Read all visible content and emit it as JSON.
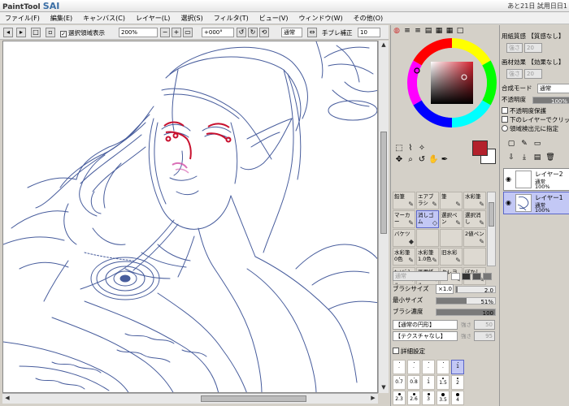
{
  "app": {
    "logo_small": "PaintTool",
    "logo_big": "SAI",
    "trial_notice": "あと21日 試用日日1"
  },
  "menu": [
    "ファイル(F)",
    "編集(E)",
    "キャンバス(C)",
    "レイヤー(L)",
    "選択(S)",
    "フィルタ(T)",
    "ビュー(V)",
    "ウィンドウ(W)",
    "その他(O)"
  ],
  "toolbar": {
    "show_selection_label": "選択領域表示",
    "zoom_value": "200%",
    "angle_value": "+000°",
    "blend_mode": "通常",
    "stabilizer_label": "手ブレ補正",
    "stabilizer_value": "10"
  },
  "tools": [
    {
      "label": "鉛筆",
      "icon": "✎"
    },
    {
      "label": "エアブラシ",
      "icon": "✎"
    },
    {
      "label": "筆",
      "icon": "✎"
    },
    {
      "label": "水彩筆",
      "icon": "✎"
    },
    {
      "label": "マーカー",
      "icon": "✎"
    },
    {
      "label": "消しゴム",
      "icon": "◇"
    },
    {
      "label": "選択ペン",
      "icon": "✎"
    },
    {
      "label": "選択消し",
      "icon": "✎"
    },
    {
      "label": "バケツ",
      "icon": "◆"
    },
    {
      "label": "",
      "icon": ""
    },
    {
      "label": "",
      "icon": ""
    },
    {
      "label": "2値ペン",
      "icon": "✎"
    },
    {
      "label": "水彩筆 0色",
      "icon": "✎"
    },
    {
      "label": "水彩筆 1.0色",
      "icon": "✎"
    },
    {
      "label": "旧水彩",
      "icon": "✎"
    },
    {
      "label": "",
      "icon": ""
    },
    {
      "label": "ｷｬﾝﾊﾞｽ アクリル",
      "icon": "✎"
    },
    {
      "label": "画用紙 アクリル",
      "icon": "✎"
    },
    {
      "label": "クレヨン",
      "icon": "✎"
    },
    {
      "label": "ぼかし",
      "icon": "✎"
    }
  ],
  "brush": {
    "mode": "通常",
    "size_label": "ブラシサイズ",
    "size_mult": "×1.0",
    "size_value": "2.0",
    "size_fill": 0.05,
    "min_size_label": "最小サイズ",
    "min_size_value": "51%",
    "min_size_fill": 0.51,
    "density_label": "ブラシ濃度",
    "density_value": "100",
    "density_fill": 1.0,
    "shape": "【通常の円形】",
    "shape_strength": "強さ",
    "shape_strength_value": "50",
    "texture": "【テクスチャなし】",
    "texture_strength": "強さ",
    "texture_strength_value": "95",
    "detail_label": "詳細設定"
  },
  "size_presets": [
    {
      "label": ".",
      "dot": 1
    },
    {
      "label": ".",
      "dot": 1
    },
    {
      "label": ".",
      "dot": 1
    },
    {
      "label": ".",
      "dot": 1
    },
    {
      "label": "1",
      "dot": 1
    },
    {
      "label": "0.7",
      "dot": 1
    },
    {
      "label": "0.8",
      "dot": 1
    },
    {
      "label": "1",
      "dot": 1
    },
    {
      "label": "1.5",
      "dot": 2
    },
    {
      "label": "2",
      "dot": 2
    },
    {
      "label": "2.3",
      "dot": 3
    },
    {
      "label": "2.6",
      "dot": 3
    },
    {
      "label": "3",
      "dot": 3
    },
    {
      "label": "3.5",
      "dot": 4
    },
    {
      "label": "4",
      "dot": 4
    }
  ],
  "layers_panel": {
    "paper_texture_label": "用紙質感",
    "paper_texture_value": "【質感なし】",
    "paper_strength_label": "強さ",
    "paper_strength_value": "20",
    "paper_effect_label": "画材効果",
    "paper_effect_value": "【効果なし】",
    "paper_effect_strength_label": "強さ",
    "paper_effect_strength_value": "20",
    "blend_label": "合成モード",
    "blend_value": "通常",
    "opacity_label": "不透明度",
    "opacity_value": "100%",
    "protect_opacity": "不透明度保護",
    "clip_lower": "下のレイヤーでクリッピング",
    "selection_source": "領域検出元に指定",
    "layers": [
      {
        "name": "レイヤー2",
        "mode": "通常",
        "opacity": "100%",
        "selected": false
      },
      {
        "name": "レイヤー1",
        "mode": "通常",
        "opacity": "100%",
        "selected": true
      }
    ]
  },
  "colors": {
    "foreground": "#b3212c",
    "background": "#ffffff",
    "sketch_line": "#27408b",
    "accent_red": "#c8102e",
    "accent_pink": "#d24fa6"
  }
}
